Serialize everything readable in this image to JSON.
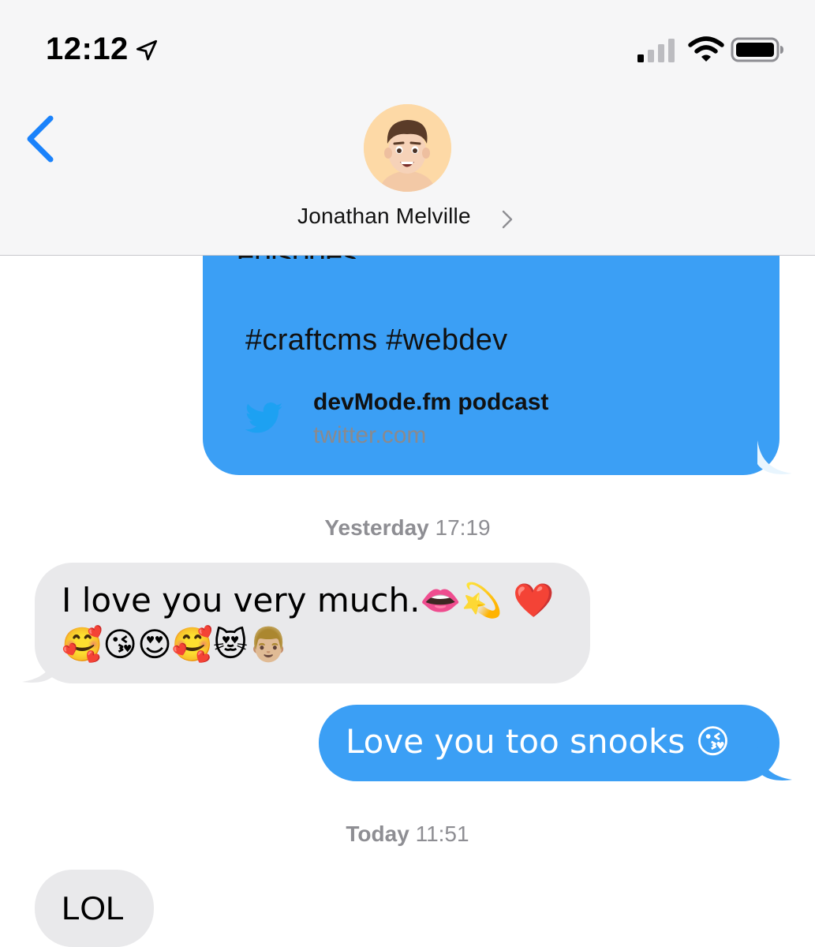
{
  "status_bar": {
    "time": "12:12",
    "icons": [
      "location-arrow-icon",
      "cellular-signal-icon",
      "wifi-icon",
      "battery-icon"
    ]
  },
  "nav": {
    "back_icon": "chevron-left-icon",
    "contact_name": "Jonathan Melville",
    "contact_chevron": "chevron-right-icon",
    "avatar": "memoji-avatar"
  },
  "link_preview": {
    "truncated_text": "episodes",
    "hashtags": "#craftcms #webdev",
    "icon": "twitter-bird-icon",
    "title": "devMode.fm podcast",
    "domain": "twitter.com"
  },
  "timestamps": [
    {
      "day": "Yesterday",
      "time": "17:19"
    },
    {
      "day": "Today",
      "time": "11:51"
    }
  ],
  "messages": [
    {
      "direction": "incoming",
      "line1": "I love you very much.👄💫 ❤️",
      "line2": "🥰😘😍🥰😻👨🏼"
    },
    {
      "direction": "outgoing",
      "text": "Love you too snooks 😘"
    },
    {
      "direction": "incoming",
      "text": "LOL"
    }
  ],
  "colors": {
    "accent_blue": "#1a82fb",
    "outgoing_bubble": "#3b9ff5",
    "incoming_bubble": "#e9e9eb",
    "link_bubble": "#e8f5fe",
    "twitter_blue": "#1da1f2",
    "header_bg": "#f6f6f7",
    "avatar_bg": "#fdd9a6"
  }
}
